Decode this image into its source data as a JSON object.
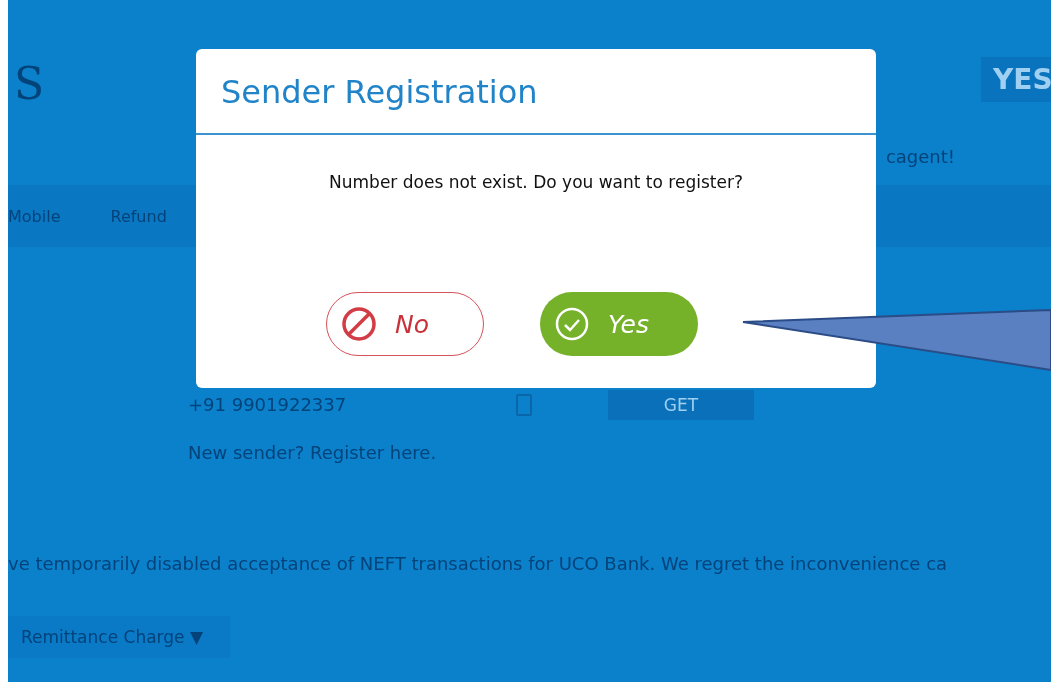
{
  "background": {
    "logo": "S",
    "bank_badge": "YES",
    "welcome_tail": "cagent!",
    "nav": [
      "Mobile",
      "Refund"
    ],
    "phone_value": "+91 9901922337",
    "get_button": "GET",
    "register_link": "New sender? Register here.",
    "notice": "ve temporarily disabled acceptance of NEFT transactions for UCO Bank. We regret the inconvenience ca",
    "charge_button": "Remittance Charge ▼"
  },
  "dialog": {
    "title": "Sender Registration",
    "message": "Number does not exist. Do you want to register?",
    "buttons": [
      {
        "kind": "no",
        "label": "No"
      },
      {
        "kind": "yes",
        "label": "Yes"
      }
    ]
  },
  "callout": {
    "kind": "pointer"
  }
}
